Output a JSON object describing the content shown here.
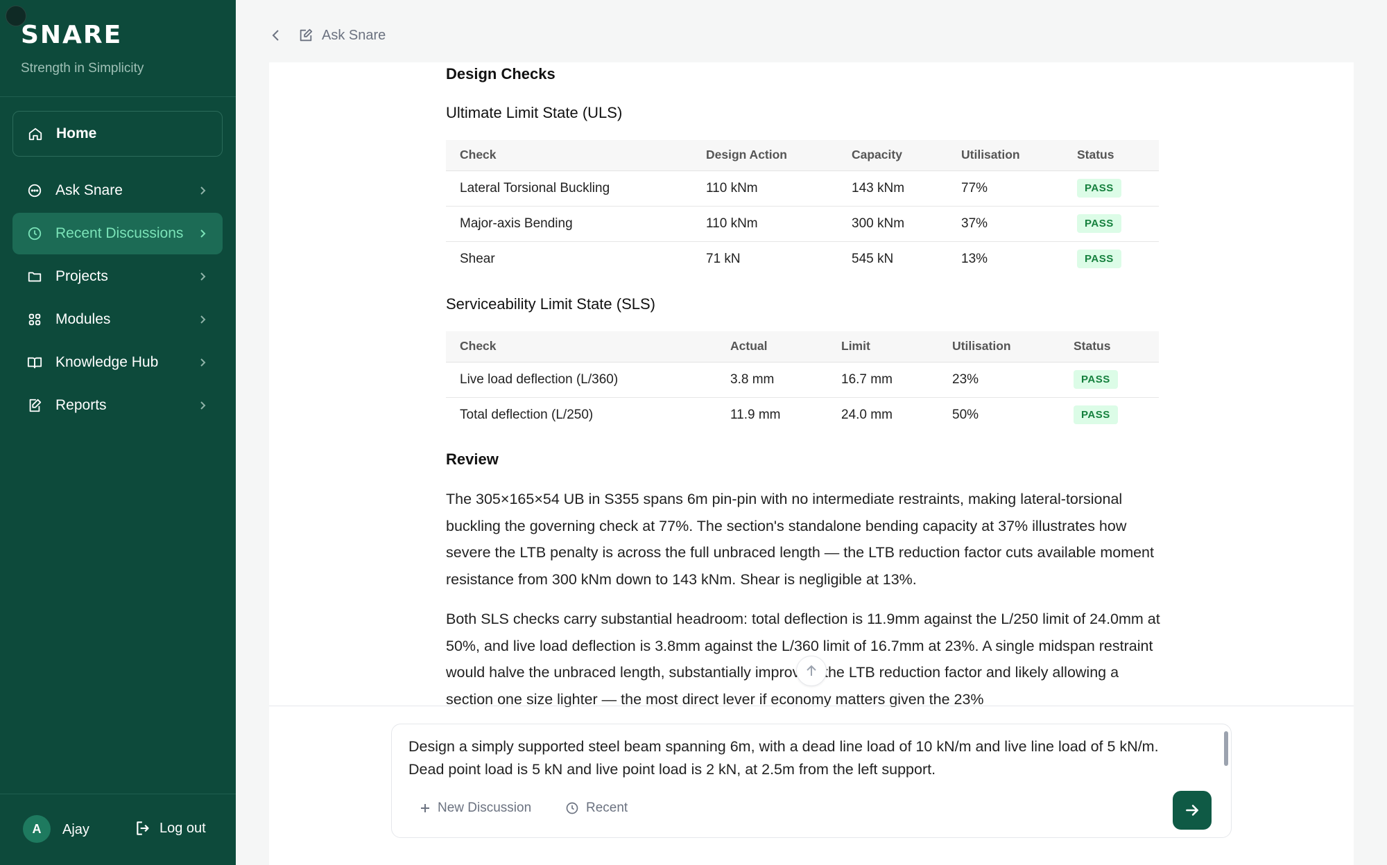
{
  "sidebar": {
    "brand": "SNARE",
    "tagline": "Strength in Simplicity",
    "items": [
      {
        "label": "Home",
        "icon": "home-icon"
      },
      {
        "label": "Ask Snare",
        "icon": "chat-icon"
      },
      {
        "label": "Recent Discussions",
        "icon": "clock-icon"
      },
      {
        "label": "Projects",
        "icon": "folder-icon"
      },
      {
        "label": "Modules",
        "icon": "grid-icon"
      },
      {
        "label": "Knowledge Hub",
        "icon": "book-icon"
      },
      {
        "label": "Reports",
        "icon": "report-icon"
      }
    ],
    "active": "Recent Discussions",
    "user": {
      "initial": "A",
      "name": "Ajay"
    },
    "logout_label": "Log out"
  },
  "header": {
    "title": "Ask Snare"
  },
  "content": {
    "design_checks_heading": "Design Checks",
    "uls": {
      "heading": "Ultimate Limit State (ULS)",
      "columns": [
        "Check",
        "Design Action",
        "Capacity",
        "Utilisation",
        "Status"
      ],
      "rows": [
        [
          "Lateral Torsional Buckling",
          "110 kNm",
          "143 kNm",
          "77%",
          "PASS"
        ],
        [
          "Major-axis Bending",
          "110 kNm",
          "300 kNm",
          "37%",
          "PASS"
        ],
        [
          "Shear",
          "71 kN",
          "545 kN",
          "13%",
          "PASS"
        ]
      ]
    },
    "sls": {
      "heading": "Serviceability Limit State (SLS)",
      "columns": [
        "Check",
        "Actual",
        "Limit",
        "Utilisation",
        "Status"
      ],
      "rows": [
        [
          "Live load deflection (L/360)",
          "3.8 mm",
          "16.7 mm",
          "23%",
          "PASS"
        ],
        [
          "Total deflection (L/250)",
          "11.9 mm",
          "24.0 mm",
          "50%",
          "PASS"
        ]
      ]
    },
    "review_heading": "Review",
    "review_p1": "The 305×165×54 UB in S355 spans 6m pin-pin with no intermediate restraints, making lateral-torsional buckling the governing check at 77%. The section's standalone bending capacity at 37% illustrates how severe the LTB penalty is across the full unbraced length — the LTB reduction factor cuts available moment resistance from 300 kNm down to 143 kNm. Shear is negligible at 13%.",
    "review_p2": "Both SLS checks carry substantial headroom: total deflection is 11.9mm against the L/250 limit of 24.0mm at 50%, and live load deflection is 3.8mm against the L/360 limit of 16.7mm at 23%. A single midspan restraint would halve the unbraced length, substantially improving the LTB reduction factor and likely allowing a section one size lighter — the most direct lever if economy matters given the 23%"
  },
  "composer": {
    "text": "Design a simply supported steel beam spanning 6m, with a dead line load of 10 kN/m and live line load of 5 kN/m.\nDead point load is 5 kN and live point load is 2 kN, at 2.5m from the left support.",
    "new_discussion_label": "New Discussion",
    "recent_label": "Recent"
  },
  "colors": {
    "sidebar": "#0d4a3b",
    "active_bg": "#1c6b55",
    "active_text": "#7be3b8",
    "pass_bg": "#dcfce7",
    "pass_text": "#15803d",
    "send": "#0f5a45"
  }
}
